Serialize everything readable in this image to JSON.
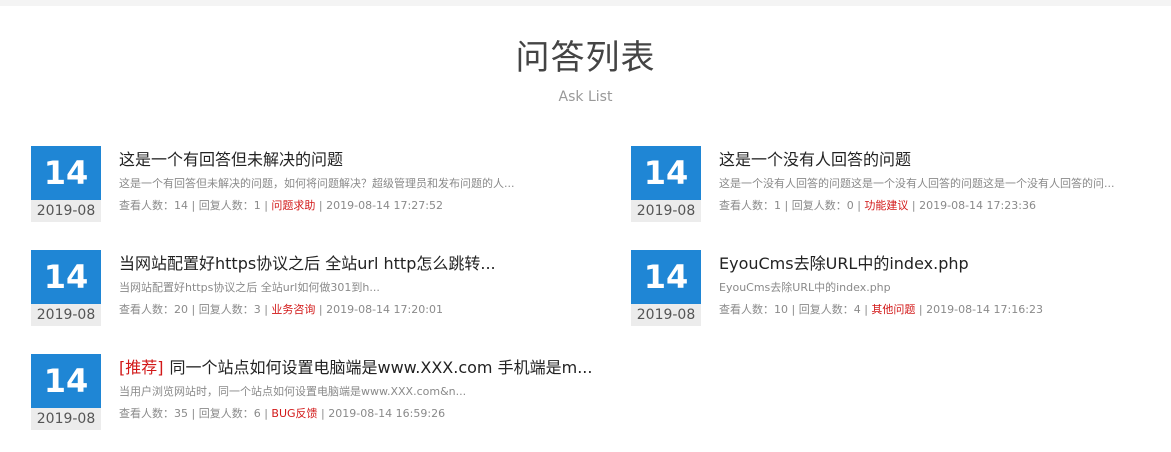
{
  "header": {
    "title": "问答列表",
    "subtitle": "Ask List"
  },
  "labels": {
    "views": "查看人数：",
    "replies": "回复人数：",
    "sep": " | "
  },
  "items": [
    {
      "day": "14",
      "month": "2019-08",
      "tag": "",
      "title": "这是一个有回答但未解决的问题",
      "desc": "这是一个有回答但未解决的问题，如何将问题解决？超级管理员和发布问题的人...",
      "views": "14",
      "replies": "1",
      "category": "问题求助",
      "time": "2019-08-14 17:27:52"
    },
    {
      "day": "14",
      "month": "2019-08",
      "tag": "",
      "title": "这是一个没有人回答的问题",
      "desc": "这是一个没有人回答的问题这是一个没有人回答的问题这是一个没有人回答的问...",
      "views": "1",
      "replies": "0",
      "category": "功能建议",
      "time": "2019-08-14 17:23:36"
    },
    {
      "day": "14",
      "month": "2019-08",
      "tag": "",
      "title": "当网站配置好https协议之后 全站url http怎么跳转...",
      "desc": "当网站配置好https协议之后  全站url如何做301到h...",
      "views": "20",
      "replies": "3",
      "category": "业务咨询",
      "time": "2019-08-14 17:20:01"
    },
    {
      "day": "14",
      "month": "2019-08",
      "tag": "",
      "title": "EyouCms去除URL中的index.php",
      "desc": "EyouCms去除URL中的index.php",
      "views": "10",
      "replies": "4",
      "category": "其他问题",
      "time": "2019-08-14 17:16:23"
    },
    {
      "day": "14",
      "month": "2019-08",
      "tag": "[推荐]",
      "title": "同一个站点如何设置电脑端是www.XXX.com 手机端是m...",
      "desc": "当用户浏览网站时，同一个站点如何设置电脑端是www.XXX.com&n...",
      "views": "35",
      "replies": "6",
      "category": "BUG反馈",
      "time": "2019-08-14 16:59:26"
    }
  ]
}
